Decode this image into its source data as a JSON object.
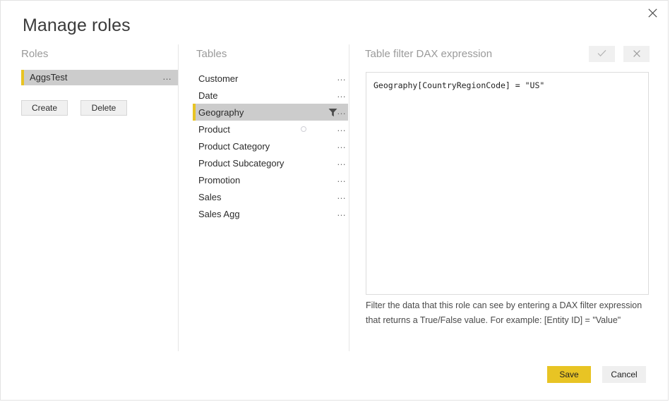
{
  "dialog": {
    "title": "Manage roles",
    "close_icon": "close-icon"
  },
  "roles": {
    "heading": "Roles",
    "items": [
      {
        "label": "AggsTest",
        "selected": true,
        "menu_icon": "ellipsis-icon"
      }
    ],
    "buttons": {
      "create": "Create",
      "delete": "Delete"
    }
  },
  "tables": {
    "heading": "Tables",
    "items": [
      {
        "label": "Customer",
        "selected": false,
        "filtered": false
      },
      {
        "label": "Date",
        "selected": false,
        "filtered": false
      },
      {
        "label": "Geography",
        "selected": true,
        "filtered": true
      },
      {
        "label": "Product",
        "selected": false,
        "filtered": false
      },
      {
        "label": "Product Category",
        "selected": false,
        "filtered": false
      },
      {
        "label": "Product Subcategory",
        "selected": false,
        "filtered": false
      },
      {
        "label": "Promotion",
        "selected": false,
        "filtered": false
      },
      {
        "label": "Sales",
        "selected": false,
        "filtered": false
      },
      {
        "label": "Sales Agg",
        "selected": false,
        "filtered": false
      }
    ],
    "menu_icon": "ellipsis-icon",
    "filter_icon": "funnel-icon"
  },
  "dax": {
    "heading": "Table filter DAX expression",
    "accept_icon": "checkmark-icon",
    "reject_icon": "close-icon",
    "expression": "Geography[CountryRegionCode] = \"US\"",
    "placeholder": "",
    "help_line_1": "Filter the data that this role can see by entering a DAX filter expression",
    "help_line_2": "that returns a True/False value. For example: [Entity ID] = \"Value\""
  },
  "footer": {
    "save": "Save",
    "cancel": "Cancel"
  },
  "colors": {
    "accent_yellow": "#e8c424",
    "selection_gray": "#cccccc",
    "button_gray": "#f0f0f0",
    "heading_gray": "#9a9a9a"
  }
}
